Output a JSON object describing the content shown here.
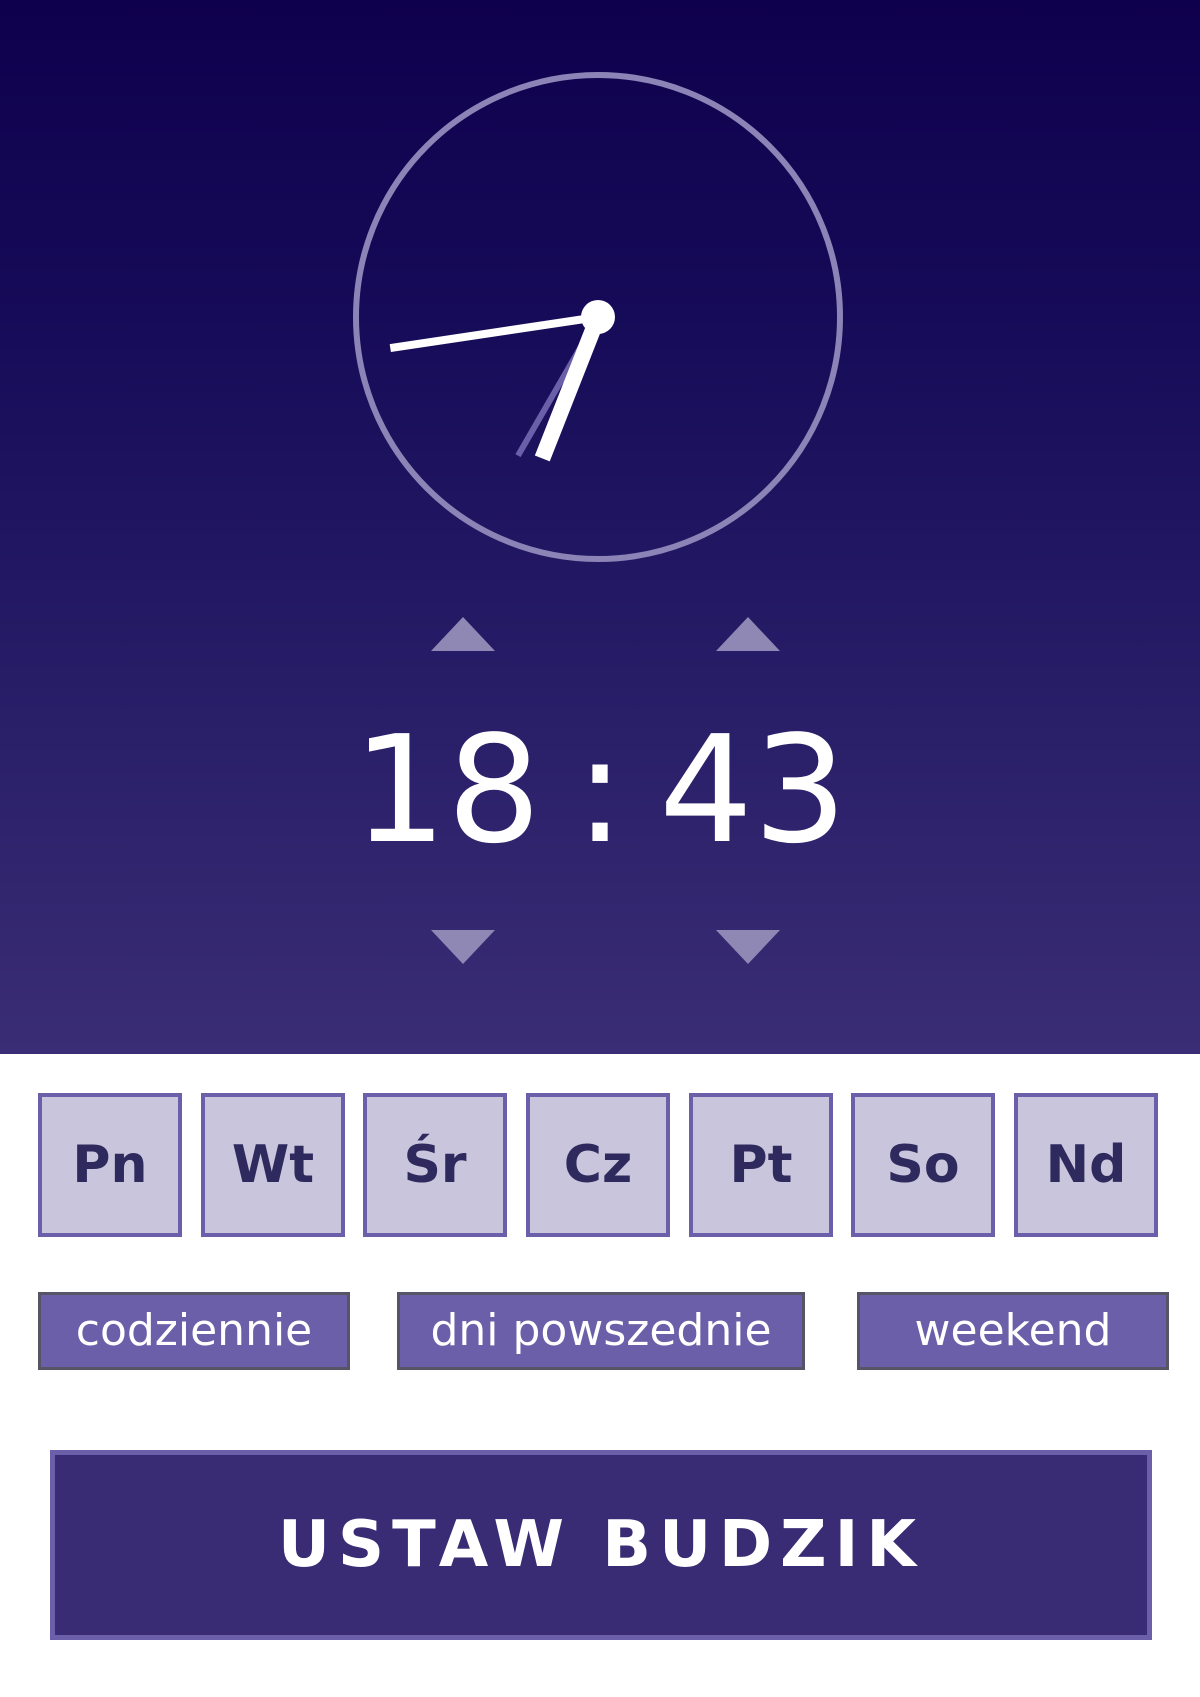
{
  "clock": {
    "hour": 18,
    "minute": 43,
    "second": 35
  },
  "time": {
    "hours": "18",
    "separator": ":",
    "minutes": "43"
  },
  "controls": {
    "hours_up": "increment-hours",
    "hours_down": "decrement-hours",
    "minutes_up": "increment-minutes",
    "minutes_down": "decrement-minutes"
  },
  "days": [
    {
      "label": "Pn"
    },
    {
      "label": "Wt"
    },
    {
      "label": "Śr"
    },
    {
      "label": "Cz"
    },
    {
      "label": "Pt"
    },
    {
      "label": "So"
    },
    {
      "label": "Nd"
    }
  ],
  "presets": {
    "everyday": "codziennie",
    "weekdays": "dni powszednie",
    "weekend": "weekend"
  },
  "action": {
    "set_alarm": "USTAW BUDZIK"
  },
  "colors": {
    "background_top": "#0f004d",
    "background_bottom": "#3a2d75",
    "accent": "#6a5fa8",
    "day_fill": "#c8c5dc",
    "day_text": "#2f2a5e",
    "button_fill": "#392c74"
  }
}
